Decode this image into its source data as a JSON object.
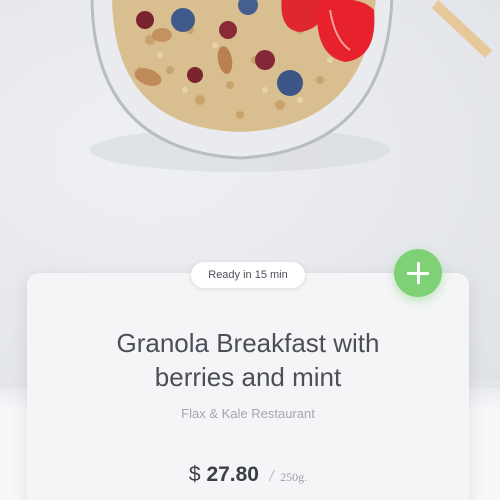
{
  "badge": {
    "ready_text": "Ready in 15 min"
  },
  "add_button": {
    "icon": "plus-icon",
    "color": "#7ed175"
  },
  "product": {
    "title_line1": "Granola Breakfast with",
    "title_line2": "berries and mint",
    "restaurant": "Flax & Kale Restaurant",
    "currency": "$",
    "price": "27.80",
    "separator": "/",
    "weight": "250g."
  },
  "colors": {
    "accent": "#7ed175",
    "title_text": "#4a4f59",
    "muted_text": "#a3a7ae"
  }
}
